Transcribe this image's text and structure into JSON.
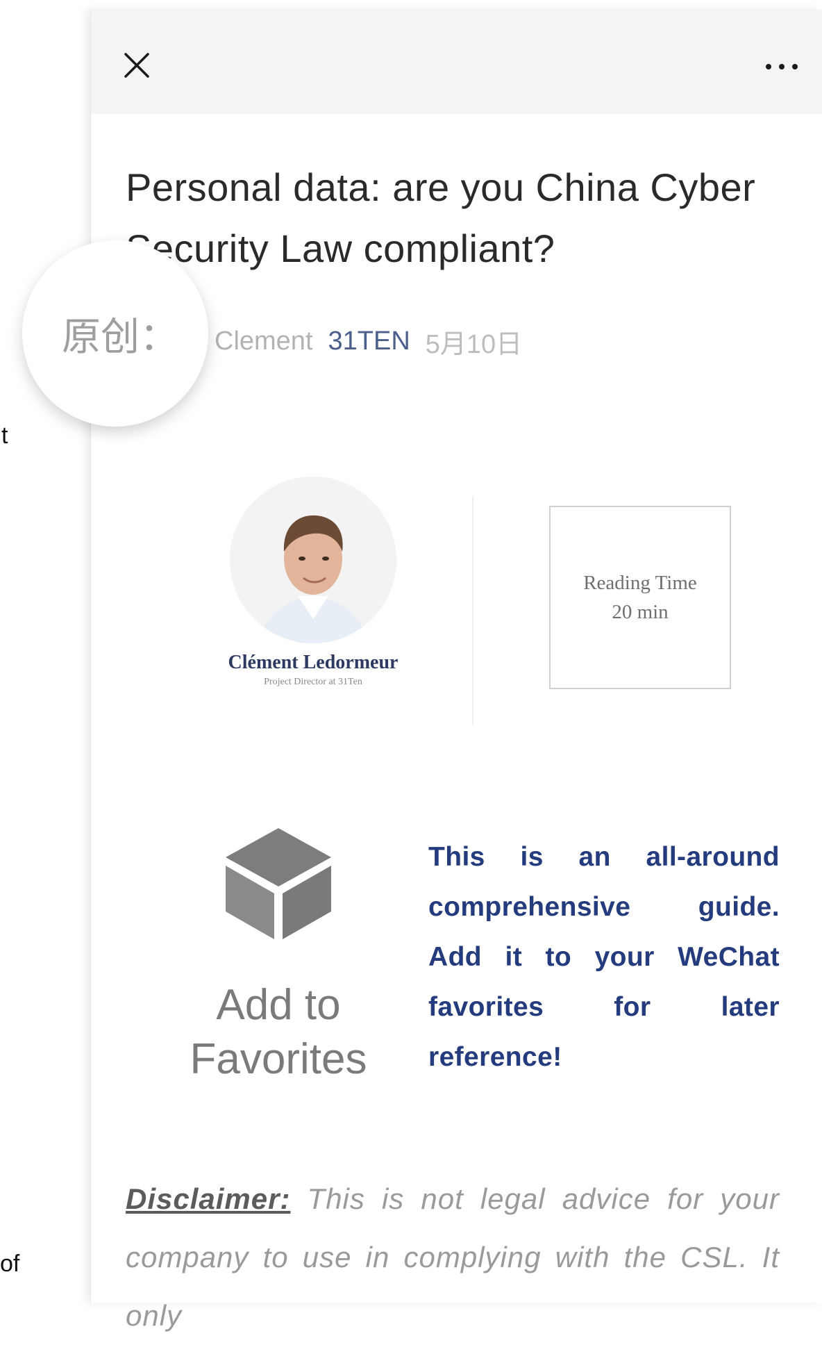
{
  "background": {
    "fragment_top": "t",
    "fragment_bottom": "of"
  },
  "header": {
    "close_icon": "close-icon",
    "more_icon": "more-icon"
  },
  "article": {
    "title": "Personal data: are you China Cyber Security Law compliant?",
    "meta": {
      "prefix": "原创：",
      "author": "Clement",
      "account": "31TEN",
      "date": "5月10日"
    },
    "author_card": {
      "name": "Clément Ledormeur",
      "role": "Project Director at 31Ten"
    },
    "reading_time": {
      "label": "Reading Time",
      "value": "20 min"
    },
    "favorites": {
      "label_line1": "Add to",
      "label_line2": "Favorites",
      "text": "This is an all-around comprehensive guide. Add it to your WeChat favorites for later reference!"
    },
    "disclaimer": {
      "label": "Disclaimer:",
      "text": " This is not legal advice for your company to use in complying with the CSL. It only"
    }
  },
  "colors": {
    "title": "#2a2a2a",
    "account_link": "#4a5f8a",
    "favorites_text": "#243c7e",
    "topbar": "#f4f4f4"
  }
}
